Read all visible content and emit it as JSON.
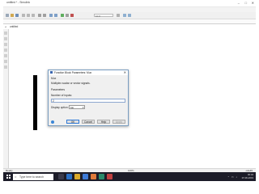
{
  "window": {
    "title": "untitled * - Simulink",
    "controls": [
      "–",
      "□",
      "✕"
    ]
  },
  "menu": [
    "File",
    "Edit",
    "View",
    "Display",
    "Diagram",
    "Simulation",
    "Analysis",
    "Code",
    "Tools",
    "Help"
  ],
  "toolbar": {
    "sim_time": "10.0"
  },
  "model_tab": "untitled",
  "address": {
    "path": "untitled"
  },
  "status": {
    "left": "Ready",
    "center": "100%",
    "right": "ode45"
  },
  "dialog": {
    "title": "Function Block Parameters: Mux",
    "block_name": "Mux",
    "description": "Multiplex scalar or vector signals.",
    "parameters_heading": "Parameters",
    "num_inputs_label": "Number of inputs:",
    "num_inputs_value": "2",
    "display_option_label": "Display option:",
    "display_option_value": "bar",
    "buttons": {
      "ok": "OK",
      "cancel": "Cancel",
      "help": "Help",
      "apply": "Apply"
    }
  },
  "taskbar": {
    "search_placeholder": "Type here to search",
    "time": "00:34",
    "date": "07-06-2019"
  }
}
